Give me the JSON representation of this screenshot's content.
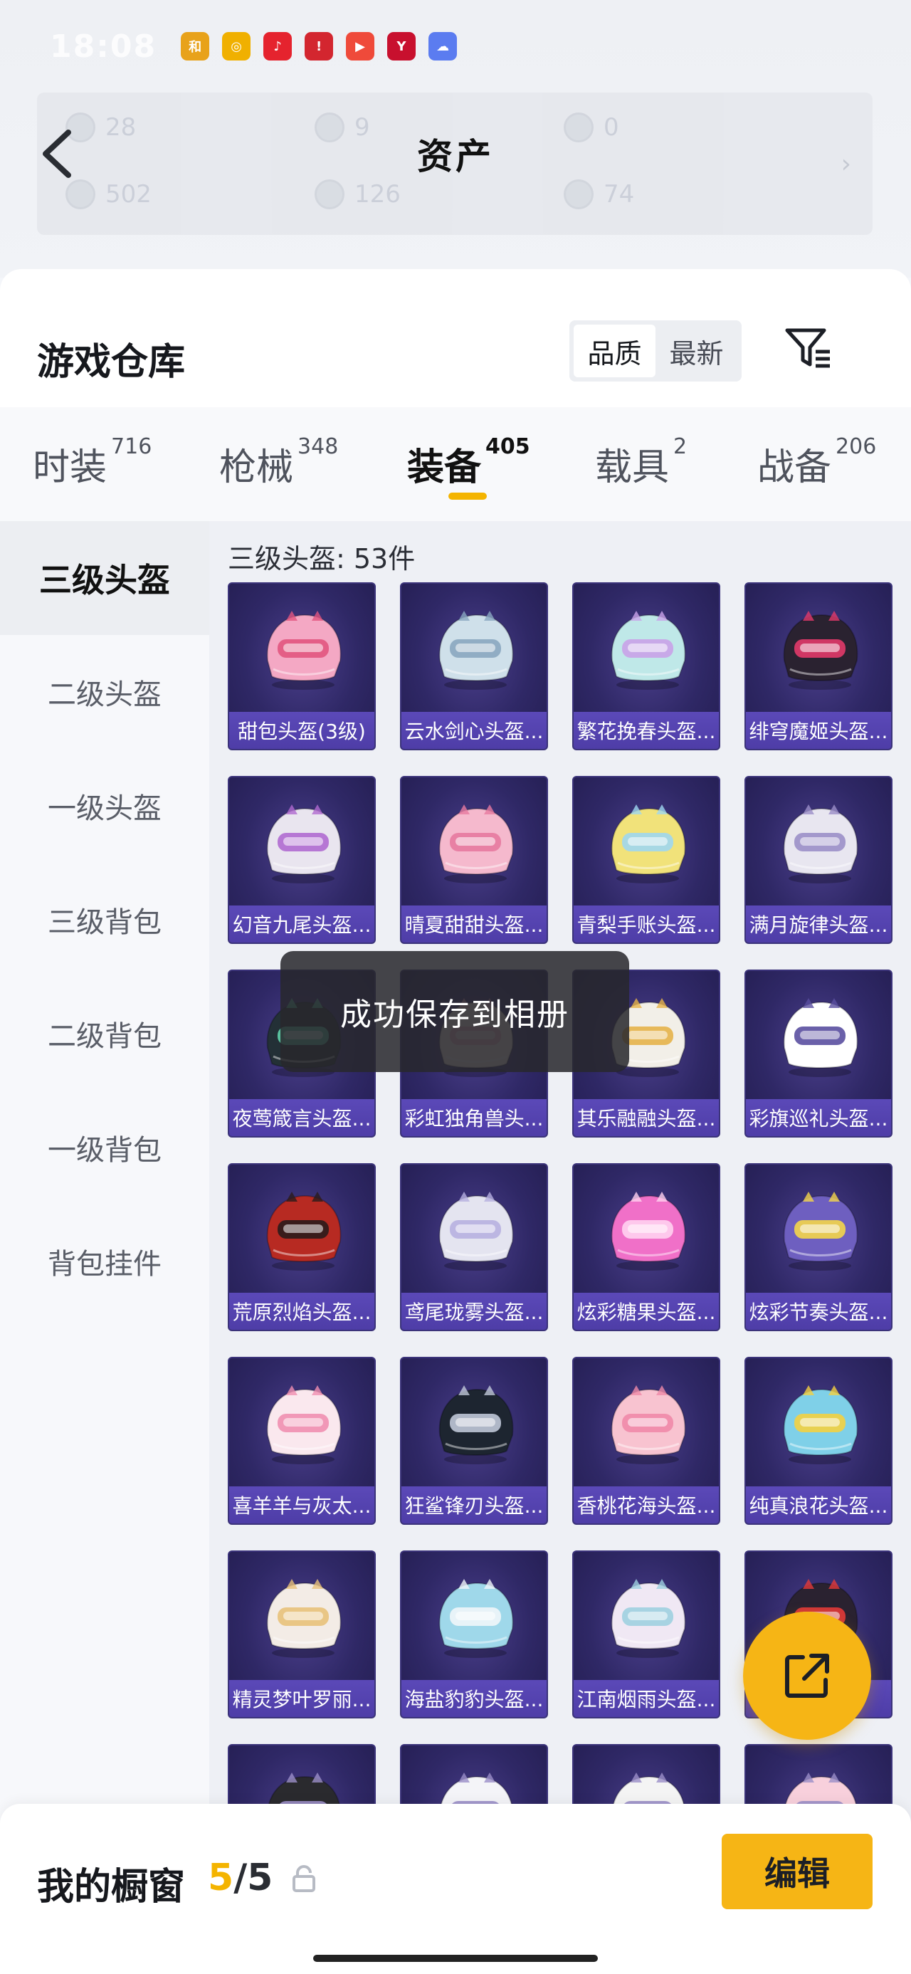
{
  "status_bar": {
    "time": "18:08",
    "apps": [
      {
        "icon": "app-game-icon",
        "color": "#e8a21a",
        "glyph": "和"
      },
      {
        "icon": "app-music-icon",
        "color": "#f0b000",
        "glyph": "◎"
      },
      {
        "icon": "app-note-icon",
        "color": "#e5232e",
        "glyph": "♪"
      },
      {
        "icon": "app-notice-icon",
        "color": "#d3262f",
        "glyph": "!"
      },
      {
        "icon": "app-video-icon",
        "color": "#ef4a3a",
        "glyph": "▶"
      },
      {
        "icon": "app-shop-icon",
        "color": "#c8102e",
        "glyph": "Y"
      },
      {
        "icon": "app-weather-icon",
        "color": "#5b7cf0",
        "glyph": "☁"
      }
    ]
  },
  "header": {
    "title": "资产",
    "assets": [
      {
        "value": "28"
      },
      {
        "value": "9"
      },
      {
        "value": "0"
      },
      {
        "value": "502"
      },
      {
        "value": "126"
      },
      {
        "value": "74"
      }
    ]
  },
  "warehouse": {
    "title": "游戏仓库",
    "sort_options": [
      "品质",
      "最新"
    ],
    "active_sort": "品质"
  },
  "tabs": [
    {
      "label": "时装",
      "count": "716"
    },
    {
      "label": "枪械",
      "count": "348"
    },
    {
      "label": "装备",
      "count": "405"
    },
    {
      "label": "载具",
      "count": "2"
    },
    {
      "label": "战备",
      "count": "206"
    }
  ],
  "active_tab": "装备",
  "side_nav": [
    "三级头盔",
    "二级头盔",
    "一级头盔",
    "三级背包",
    "二级背包",
    "一级背包",
    "背包挂件"
  ],
  "active_side": "三级头盔",
  "grid": {
    "count_label": "三级头盔: 53件",
    "items": [
      {
        "name": "甜包头盔(3级)",
        "color": "#f4a8c4",
        "accent": "#e2557f"
      },
      {
        "name": "云水剑心头盔...",
        "color": "#cfe0ea",
        "accent": "#8aa7c0"
      },
      {
        "name": "繁花挽春头盔...",
        "color": "#bfe8e8",
        "accent": "#c9a2e8"
      },
      {
        "name": "绯穹魔姬头盔...",
        "color": "#2a2230",
        "accent": "#e23a6a"
      },
      {
        "name": "幻音九尾头盔...",
        "color": "#e9e5ef",
        "accent": "#b06ad0"
      },
      {
        "name": "晴夏甜甜头盔...",
        "color": "#f5b9cd",
        "accent": "#e77aa0"
      },
      {
        "name": "青梨手账头盔...",
        "color": "#f1e27a",
        "accent": "#9fd7f0"
      },
      {
        "name": "满月旋律头盔...",
        "color": "#e8e6f0",
        "accent": "#9b8fc8"
      },
      {
        "name": "夜莺箴言头盔...",
        "color": "#233036",
        "accent": "#5fd0a8"
      },
      {
        "name": "彩虹独角兽头...",
        "color": "#f3e6df",
        "accent": "#f0b0c0"
      },
      {
        "name": "其乐融融头盔...",
        "color": "#f2efe8",
        "accent": "#e6b34a"
      },
      {
        "name": "彩旗巡礼头盔...",
        "color": "#ffffff",
        "accent": "#5a4fa0"
      },
      {
        "name": "荒原烈焰头盔...",
        "color": "#b72a22",
        "accent": "#2b1b1b"
      },
      {
        "name": "鸢尾珑雾头盔...",
        "color": "#e4e4f0",
        "accent": "#b7b0e0"
      },
      {
        "name": "炫彩糖果头盔...",
        "color": "#f070c8",
        "accent": "#ffd2ef"
      },
      {
        "name": "炫彩节奏头盔...",
        "color": "#6e5fc0",
        "accent": "#f4d64a"
      },
      {
        "name": "喜羊羊与灰太...",
        "color": "#fae8ee",
        "accent": "#f08fb0"
      },
      {
        "name": "狂鲨锋刃头盔...",
        "color": "#1d2530",
        "accent": "#c0c8d8"
      },
      {
        "name": "香桃花海头盔...",
        "color": "#f8c3d0",
        "accent": "#ef8aa8"
      },
      {
        "name": "纯真浪花头盔...",
        "color": "#7fd0e8",
        "accent": "#f4d040"
      },
      {
        "name": "精灵梦叶罗丽...",
        "color": "#f3ece6",
        "accent": "#e8c27a"
      },
      {
        "name": "海盐豹豹头盔...",
        "color": "#9fd8ea",
        "accent": "#f0f6fa"
      },
      {
        "name": "江南烟雨头盔...",
        "color": "#f0e8f4",
        "accent": "#9fd0e0"
      },
      {
        "name": "",
        "color": "#2a2230",
        "accent": "#e23a3a"
      }
    ],
    "partial_row": [
      {
        "color": "#2a2a2e"
      },
      {
        "color": "#f4f4f8"
      },
      {
        "color": "#f4f4f4"
      },
      {
        "color": "#f8d0dc"
      }
    ]
  },
  "toast": "成功保存到相册",
  "bottom_bar": {
    "title": "我的橱窗",
    "count_current": "5",
    "count_total": "/5",
    "edit_label": "编辑"
  },
  "colors": {
    "accent": "#f6b515",
    "card_bg": "#2f2866",
    "card_label": "#4e3da7"
  }
}
